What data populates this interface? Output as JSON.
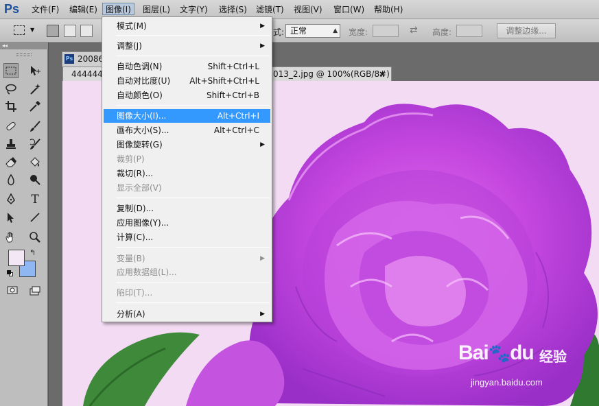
{
  "app": {
    "logo": "Ps"
  },
  "menubar": {
    "items": [
      {
        "label": "文件(F)"
      },
      {
        "label": "编辑(E)"
      },
      {
        "label": "图像(I)"
      },
      {
        "label": "图层(L)"
      },
      {
        "label": "文字(Y)"
      },
      {
        "label": "选择(S)"
      },
      {
        "label": "滤镜(T)"
      },
      {
        "label": "视图(V)"
      },
      {
        "label": "窗口(W)"
      },
      {
        "label": "帮助(H)"
      }
    ]
  },
  "options": {
    "style_label": "式:",
    "style_value": "正常",
    "width_label": "宽度:",
    "height_label": "高度:",
    "refine_edge": "调整边缘..."
  },
  "document": {
    "tab1_title": "20086",
    "tab2_title_left": "444444",
    "tab2_title_right": "013_2.jpg @ 100%(RGB/8#)",
    "tab_close": "×"
  },
  "image_menu": {
    "items": [
      {
        "label": "模式(M)",
        "shortcut": "",
        "submenu": true,
        "disabled": false
      },
      {
        "label": "调整(J)",
        "shortcut": "",
        "submenu": true,
        "disabled": false
      },
      {
        "label": "自动色调(N)",
        "shortcut": "Shift+Ctrl+L",
        "submenu": false,
        "disabled": false
      },
      {
        "label": "自动对比度(U)",
        "shortcut": "Alt+Shift+Ctrl+L",
        "submenu": false,
        "disabled": false
      },
      {
        "label": "自动颜色(O)",
        "shortcut": "Shift+Ctrl+B",
        "submenu": false,
        "disabled": false
      },
      {
        "label": "图像大小(I)...",
        "shortcut": "Alt+Ctrl+I",
        "submenu": false,
        "disabled": false,
        "highlighted": true
      },
      {
        "label": "画布大小(S)...",
        "shortcut": "Alt+Ctrl+C",
        "submenu": false,
        "disabled": false
      },
      {
        "label": "图像旋转(G)",
        "shortcut": "",
        "submenu": true,
        "disabled": false
      },
      {
        "label": "裁剪(P)",
        "shortcut": "",
        "submenu": false,
        "disabled": true
      },
      {
        "label": "裁切(R)...",
        "shortcut": "",
        "submenu": false,
        "disabled": false
      },
      {
        "label": "显示全部(V)",
        "shortcut": "",
        "submenu": false,
        "disabled": true
      },
      {
        "label": "复制(D)...",
        "shortcut": "",
        "submenu": false,
        "disabled": false
      },
      {
        "label": "应用图像(Y)...",
        "shortcut": "",
        "submenu": false,
        "disabled": false
      },
      {
        "label": "计算(C)...",
        "shortcut": "",
        "submenu": false,
        "disabled": false
      },
      {
        "label": "变量(B)",
        "shortcut": "",
        "submenu": true,
        "disabled": true
      },
      {
        "label": "应用数据组(L)...",
        "shortcut": "",
        "submenu": false,
        "disabled": true
      },
      {
        "label": "陷印(T)...",
        "shortcut": "",
        "submenu": false,
        "disabled": true
      },
      {
        "label": "分析(A)",
        "shortcut": "",
        "submenu": true,
        "disabled": false
      }
    ],
    "submenu_arrow": "▶"
  },
  "toolbox": {
    "type_tool": "T",
    "foreground_color": "#f3e6f5",
    "background_color": "#8fb8f2"
  },
  "watermark": {
    "logo": "Bai",
    "logo_suffix": "du",
    "text": "经验",
    "url": "jingyan.baidu.com"
  },
  "colors": {
    "highlight": "#3399ff",
    "canvas_bg": "#f3dcf3"
  }
}
